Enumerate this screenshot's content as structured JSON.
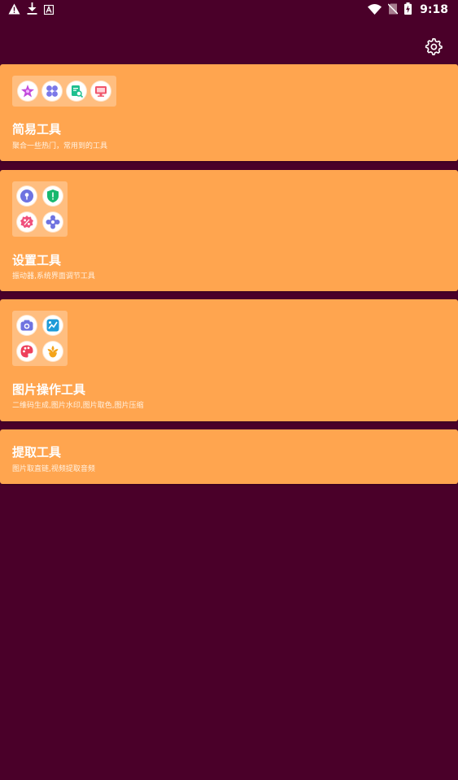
{
  "status_bar": {
    "time": "9:18",
    "left_icons": [
      "alert-icon",
      "download-icon",
      "a-box-icon"
    ],
    "right_icons": [
      "wifi-icon",
      "no-sim-icon",
      "battery-charging-icon"
    ]
  },
  "toolbar": {
    "settings_icon": "gear-icon"
  },
  "colors": {
    "background": "#4a0029",
    "card": "#ffa54f"
  },
  "cards": [
    {
      "title": "简易工具",
      "subtitle": "聚合一些热门，常用到的工具",
      "icons": [
        "flower-star-icon",
        "clover-icon",
        "document-search-icon",
        "monitor-icon"
      ]
    },
    {
      "title": "设置工具",
      "subtitle": "振动器,系统界面调节工具",
      "icons": [
        "shield-key-icon",
        "shield-alert-icon",
        "percent-badge-icon",
        "gear-flower-icon"
      ]
    },
    {
      "title": "图片操作工具",
      "subtitle": "二维码生成,图片水印,图片取色,图片压缩",
      "icons": [
        "camera-icon",
        "image-chart-icon",
        "palette-icon",
        "flower-icon"
      ]
    },
    {
      "title": "提取工具",
      "subtitle": "图片取直链,视频提取音频",
      "icons": []
    }
  ]
}
